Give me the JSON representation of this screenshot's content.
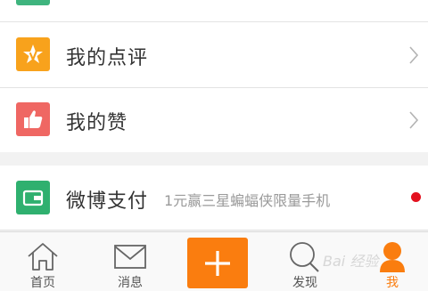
{
  "menu": {
    "review_label": "我的点评",
    "like_label": "我的赞",
    "pay_label": "微博支付",
    "pay_promo": "1元赢三星蝙蝠侠限量手机"
  },
  "tabbar": {
    "home": "首页",
    "messages": "消息",
    "discover": "发现",
    "me": "我"
  },
  "watermark": "Bai 经验",
  "colors": {
    "accent": "#fa7d0f",
    "review_icon": "#f8a21c",
    "like_icon": "#ef6763",
    "pay_icon": "#2fb06f",
    "notification_dot": "#e3111f"
  }
}
